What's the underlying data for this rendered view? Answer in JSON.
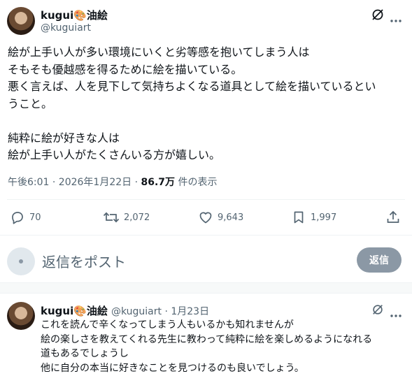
{
  "post": {
    "display_name": "kugui🎨油絵",
    "handle": "@kuguiart",
    "lines": [
      "絵が上手い人が多い環境にいくと劣等感を抱いてしまう人は",
      "そもそも優越感を得るために絵を描いている。",
      "悪く言えば、人を見下して気持ちよくなる道具として絵を描いているとい",
      "うこと。",
      "",
      "純粋に絵が好きな人は",
      "絵が上手い人がたくさんいる方が嬉しい。"
    ],
    "time": "午後6:01 · 2026年1月22日 · ",
    "views": "86.7万",
    "views_label": " 件の表示"
  },
  "actions": {
    "replies": "70",
    "reposts": "2,072",
    "likes": "9,643",
    "bookmarks": "1,997"
  },
  "composer": {
    "placeholder": "返信をポスト",
    "button": "返信"
  },
  "reply": {
    "display_name": "kugui🎨油絵",
    "handle_date": "@kuguiart · 1月23日",
    "lines": [
      "これを読んで辛くなってしまう人もいるかも知れませんが",
      "絵の楽しさを教えてくれる先生に教わって純粋に絵を楽しめるようになれる",
      "道もあるでしょうし",
      "他に自分の本当に好きなことを見つけるのも良いでしょう。"
    ]
  }
}
